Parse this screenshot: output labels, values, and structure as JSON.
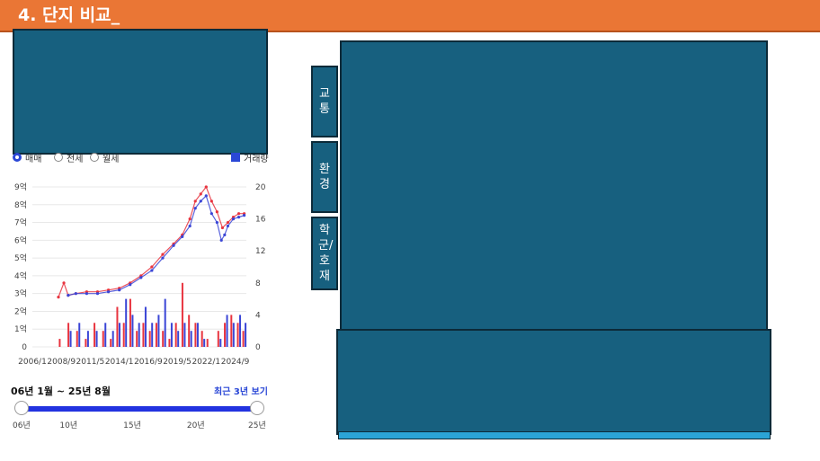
{
  "header": {
    "title": "4. 단지 비교_"
  },
  "tabs": [
    {
      "label": "교통"
    },
    {
      "label": "환경"
    },
    {
      "label": "학군/호재"
    }
  ],
  "filters": {
    "options": [
      "매매",
      "전세",
      "월세"
    ],
    "selected": "매매",
    "volume_toggle": "거래량"
  },
  "range": {
    "label": "06년 1월 ~ 25년 8월",
    "recent_link": "최근 3년 보기",
    "ticks": [
      "06년",
      "10년",
      "15년",
      "20년",
      "25년"
    ],
    "start_fraction": 0.0,
    "end_fraction": 1.0
  },
  "colors": {
    "header": "#ea7635",
    "panel": "#17607f",
    "series_red": "#e8343f",
    "series_blue": "#3a45d6"
  },
  "chart_data": {
    "type": "line",
    "x_ticks": [
      "2006/1",
      "2008/9",
      "2011/5",
      "2014/1",
      "2016/9",
      "2019/5",
      "2022/1",
      "2024/9"
    ],
    "y_left": {
      "ticks": [
        "0",
        "1억",
        "2억",
        "3억",
        "4억",
        "5억",
        "6억",
        "7억",
        "8억",
        "9억"
      ],
      "range": [
        0,
        9
      ]
    },
    "y_right": {
      "ticks": [
        "0",
        "4",
        "8",
        "12",
        "16",
        "20"
      ],
      "range": [
        0,
        20
      ]
    },
    "series": [
      {
        "color": "#e8343f",
        "years": [
          2008.4,
          2008.9,
          2009.3,
          2010,
          2011,
          2012,
          2013,
          2014,
          2015,
          2016,
          2017,
          2018,
          2019,
          2019.8,
          2020.5,
          2021,
          2021.5,
          2022,
          2022.5,
          2023,
          2023.5,
          2024,
          2024.5,
          2025,
          2025.5
        ],
        "values": [
          2.8,
          3.6,
          2.9,
          3.0,
          3.1,
          3.1,
          3.2,
          3.3,
          3.6,
          4.0,
          4.5,
          5.2,
          5.8,
          6.3,
          7.2,
          8.2,
          8.6,
          9.0,
          8.2,
          7.6,
          6.7,
          7.0,
          7.3,
          7.5,
          7.5
        ]
      },
      {
        "color": "#3a45d6",
        "years": [
          2009.3,
          2010,
          2011,
          2012,
          2013,
          2014,
          2015,
          2016,
          2017,
          2018,
          2019,
          2019.8,
          2020.5,
          2021,
          2021.5,
          2022,
          2022.5,
          2023,
          2023.4,
          2023.7,
          2024,
          2024.5,
          2025,
          2025.5
        ],
        "values": [
          2.9,
          3.0,
          3.0,
          3.0,
          3.1,
          3.2,
          3.5,
          3.9,
          4.3,
          5.0,
          5.7,
          6.2,
          6.8,
          7.8,
          8.2,
          8.5,
          7.5,
          7.0,
          6.0,
          6.3,
          6.8,
          7.2,
          7.3,
          7.4
        ]
      }
    ],
    "volume": [
      {
        "year": 2008.6,
        "red": 1,
        "blue": 0
      },
      {
        "year": 2009.4,
        "red": 3,
        "blue": 2
      },
      {
        "year": 2010.2,
        "red": 2,
        "blue": 3
      },
      {
        "year": 2011.0,
        "red": 1,
        "blue": 2
      },
      {
        "year": 2011.8,
        "red": 3,
        "blue": 2
      },
      {
        "year": 2012.6,
        "red": 2,
        "blue": 3
      },
      {
        "year": 2013.3,
        "red": 1,
        "blue": 2
      },
      {
        "year": 2013.9,
        "red": 5,
        "blue": 3
      },
      {
        "year": 2014.5,
        "red": 3,
        "blue": 6
      },
      {
        "year": 2015.1,
        "red": 6,
        "blue": 4
      },
      {
        "year": 2015.7,
        "red": 2,
        "blue": 3
      },
      {
        "year": 2016.3,
        "red": 3,
        "blue": 5
      },
      {
        "year": 2016.9,
        "red": 2,
        "blue": 3
      },
      {
        "year": 2017.5,
        "red": 3,
        "blue": 4
      },
      {
        "year": 2018.1,
        "red": 2,
        "blue": 6
      },
      {
        "year": 2018.7,
        "red": 1,
        "blue": 3
      },
      {
        "year": 2019.3,
        "red": 3,
        "blue": 2
      },
      {
        "year": 2019.9,
        "red": 8,
        "blue": 3
      },
      {
        "year": 2020.5,
        "red": 4,
        "blue": 2
      },
      {
        "year": 2021.1,
        "red": 3,
        "blue": 3
      },
      {
        "year": 2021.7,
        "red": 2,
        "blue": 1
      },
      {
        "year": 2022.2,
        "red": 1,
        "blue": 0
      },
      {
        "year": 2023.2,
        "red": 2,
        "blue": 1
      },
      {
        "year": 2023.8,
        "red": 3,
        "blue": 4
      },
      {
        "year": 2024.4,
        "red": 4,
        "blue": 3
      },
      {
        "year": 2025.0,
        "red": 3,
        "blue": 4
      },
      {
        "year": 2025.5,
        "red": 2,
        "blue": 3
      }
    ]
  }
}
